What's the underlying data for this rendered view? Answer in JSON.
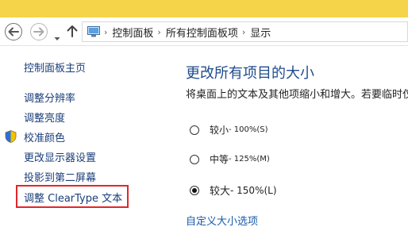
{
  "colors": {
    "title_bar": "#f6d44a",
    "link": "#1a3e7a",
    "heading": "#1f4b8c",
    "highlight_box": "#e2262c"
  },
  "nav": {
    "back_icon": "back-arrow-icon",
    "forward_icon": "forward-arrow-icon",
    "recent_icon": "chevron-down-icon",
    "up_icon": "up-arrow-icon"
  },
  "address": {
    "icon": "control-panel-icon",
    "breadcrumbs": [
      "控制面板",
      "所有控制面板项",
      "显示"
    ],
    "separator": "›"
  },
  "sidebar": {
    "home": "控制面板主页",
    "items": [
      {
        "label": "调整分辨率"
      },
      {
        "label": "调整亮度"
      },
      {
        "label": "校准颜色",
        "icon": "shield-icon"
      },
      {
        "label": "更改显示器设置"
      },
      {
        "label": "投影到第二屏幕"
      },
      {
        "label": "调整 ClearType 文本"
      }
    ]
  },
  "main": {
    "heading": "更改所有项目的大小",
    "description": "将桌面上的文本及其他项缩小和增大。若要临时仅用",
    "options": [
      {
        "label": "较小",
        "suffix": " - 100%(S)",
        "selected": false
      },
      {
        "label": "中等",
        "suffix": " - 125%(M)",
        "selected": false
      },
      {
        "label": "较大",
        "suffix": " - 150%(L)",
        "selected": true
      }
    ],
    "custom_link": "自定义大小选项"
  }
}
